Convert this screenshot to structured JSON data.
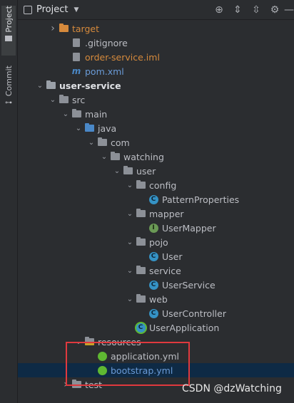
{
  "sidebar": {
    "project_label": "Project",
    "commit_label": "Commit"
  },
  "header": {
    "title": "Project"
  },
  "tree": [
    {
      "label": "target",
      "depth": 1,
      "icon": "folder-orange",
      "arrow": "right",
      "color": "#d68a3c"
    },
    {
      "label": ".gitignore",
      "depth": 2,
      "icon": "file",
      "arrow": "",
      "color": "#bcbec4"
    },
    {
      "label": "order-service.iml",
      "depth": 2,
      "icon": "file",
      "arrow": "",
      "color": "#d68a3c"
    },
    {
      "label": "pom.xml",
      "depth": 2,
      "icon": "maven",
      "arrow": "",
      "color": "#6a9bd8"
    },
    {
      "label": "user-service",
      "depth": 0,
      "icon": "module",
      "arrow": "down",
      "color": "#dfe1e5",
      "bold": true
    },
    {
      "label": "src",
      "depth": 1,
      "icon": "folder",
      "arrow": "down",
      "color": "#bcbec4"
    },
    {
      "label": "main",
      "depth": 2,
      "icon": "folder",
      "arrow": "down",
      "color": "#bcbec4"
    },
    {
      "label": "java",
      "depth": 3,
      "icon": "folder-blue",
      "arrow": "down",
      "color": "#bcbec4"
    },
    {
      "label": "com",
      "depth": 4,
      "icon": "package",
      "arrow": "down",
      "color": "#bcbec4"
    },
    {
      "label": "watching",
      "depth": 5,
      "icon": "package",
      "arrow": "down",
      "color": "#bcbec4"
    },
    {
      "label": "user",
      "depth": 6,
      "icon": "package",
      "arrow": "down",
      "color": "#bcbec4"
    },
    {
      "label": "config",
      "depth": 7,
      "icon": "package",
      "arrow": "down",
      "color": "#bcbec4"
    },
    {
      "label": "PatternProperties",
      "depth": 8,
      "icon": "class",
      "arrow": "",
      "color": "#bcbec4"
    },
    {
      "label": "mapper",
      "depth": 7,
      "icon": "package",
      "arrow": "down",
      "color": "#bcbec4"
    },
    {
      "label": "UserMapper",
      "depth": 8,
      "icon": "interface",
      "arrow": "",
      "color": "#bcbec4"
    },
    {
      "label": "pojo",
      "depth": 7,
      "icon": "package",
      "arrow": "down",
      "color": "#bcbec4"
    },
    {
      "label": "User",
      "depth": 8,
      "icon": "class",
      "arrow": "",
      "color": "#bcbec4"
    },
    {
      "label": "service",
      "depth": 7,
      "icon": "package",
      "arrow": "down",
      "color": "#bcbec4"
    },
    {
      "label": "UserService",
      "depth": 8,
      "icon": "class",
      "arrow": "",
      "color": "#bcbec4"
    },
    {
      "label": "web",
      "depth": 7,
      "icon": "package",
      "arrow": "down",
      "color": "#bcbec4"
    },
    {
      "label": "UserController",
      "depth": 8,
      "icon": "class",
      "arrow": "",
      "color": "#bcbec4"
    },
    {
      "label": "UserApplication",
      "depth": 7,
      "icon": "spring-class",
      "arrow": "",
      "color": "#bcbec4"
    },
    {
      "label": "resources",
      "depth": 3,
      "icon": "resources",
      "arrow": "down",
      "color": "#bcbec4"
    },
    {
      "label": "application.yml",
      "depth": 4,
      "icon": "spring-yml",
      "arrow": "",
      "color": "#bcbec4"
    },
    {
      "label": "bootstrap.yml",
      "depth": 4,
      "icon": "spring-yml",
      "arrow": "",
      "color": "#6a9bd8",
      "selected": true
    },
    {
      "label": "test",
      "depth": 2,
      "icon": "folder",
      "arrow": "right",
      "color": "#bcbec4"
    }
  ],
  "watermark": "CSDN @dzWatching",
  "colors": {
    "background": "#2b2d30",
    "selected_row": "#0e2a45",
    "highlight_box": "#e0393e",
    "folder": "#8c9097",
    "folder_orange": "#d68a3c",
    "folder_blue": "#4a88c7"
  }
}
